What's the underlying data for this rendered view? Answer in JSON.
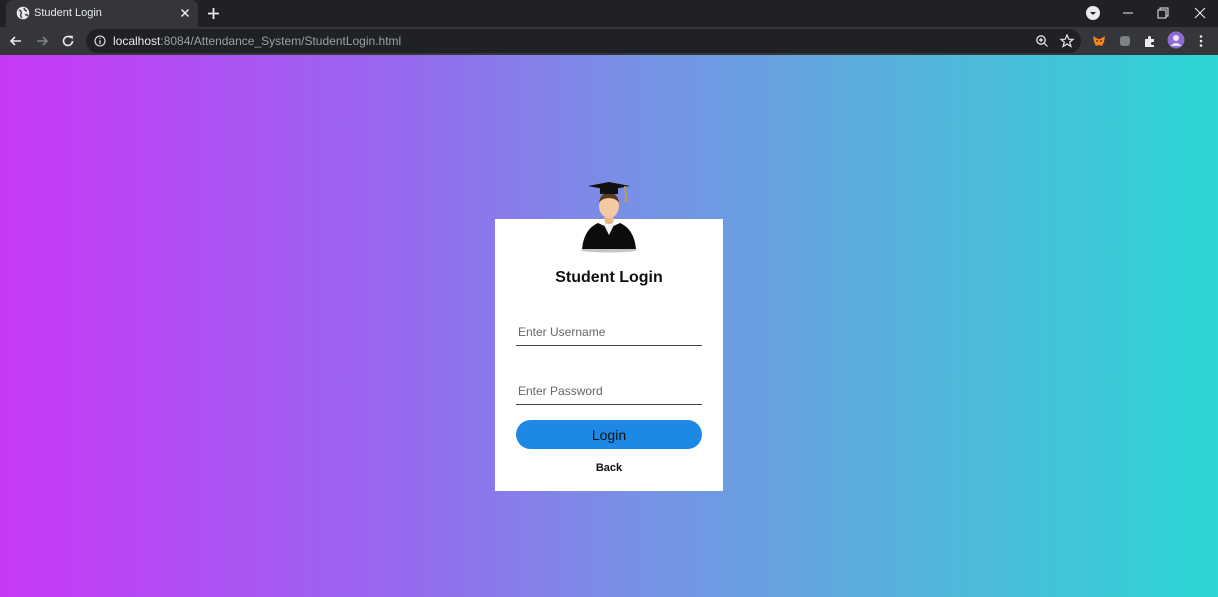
{
  "browser": {
    "tab": {
      "title": "Student Login",
      "favicon": "globe-icon"
    },
    "url": {
      "host": "localhost",
      "path": ":8084/Attendance_System/StudentLogin.html"
    },
    "colors": {
      "tabstrip": "#202124",
      "toolbar": "#35363a"
    }
  },
  "page": {
    "gradient_colors": [
      "#c838f7",
      "#2cd6d4"
    ],
    "login": {
      "title": "Student Login",
      "username_placeholder": "Enter Username",
      "password_placeholder": "Enter Password",
      "login_label": "Login",
      "back_label": "Back",
      "button_color": "#1e88e5",
      "avatar": "graduate-avatar-icon"
    }
  }
}
